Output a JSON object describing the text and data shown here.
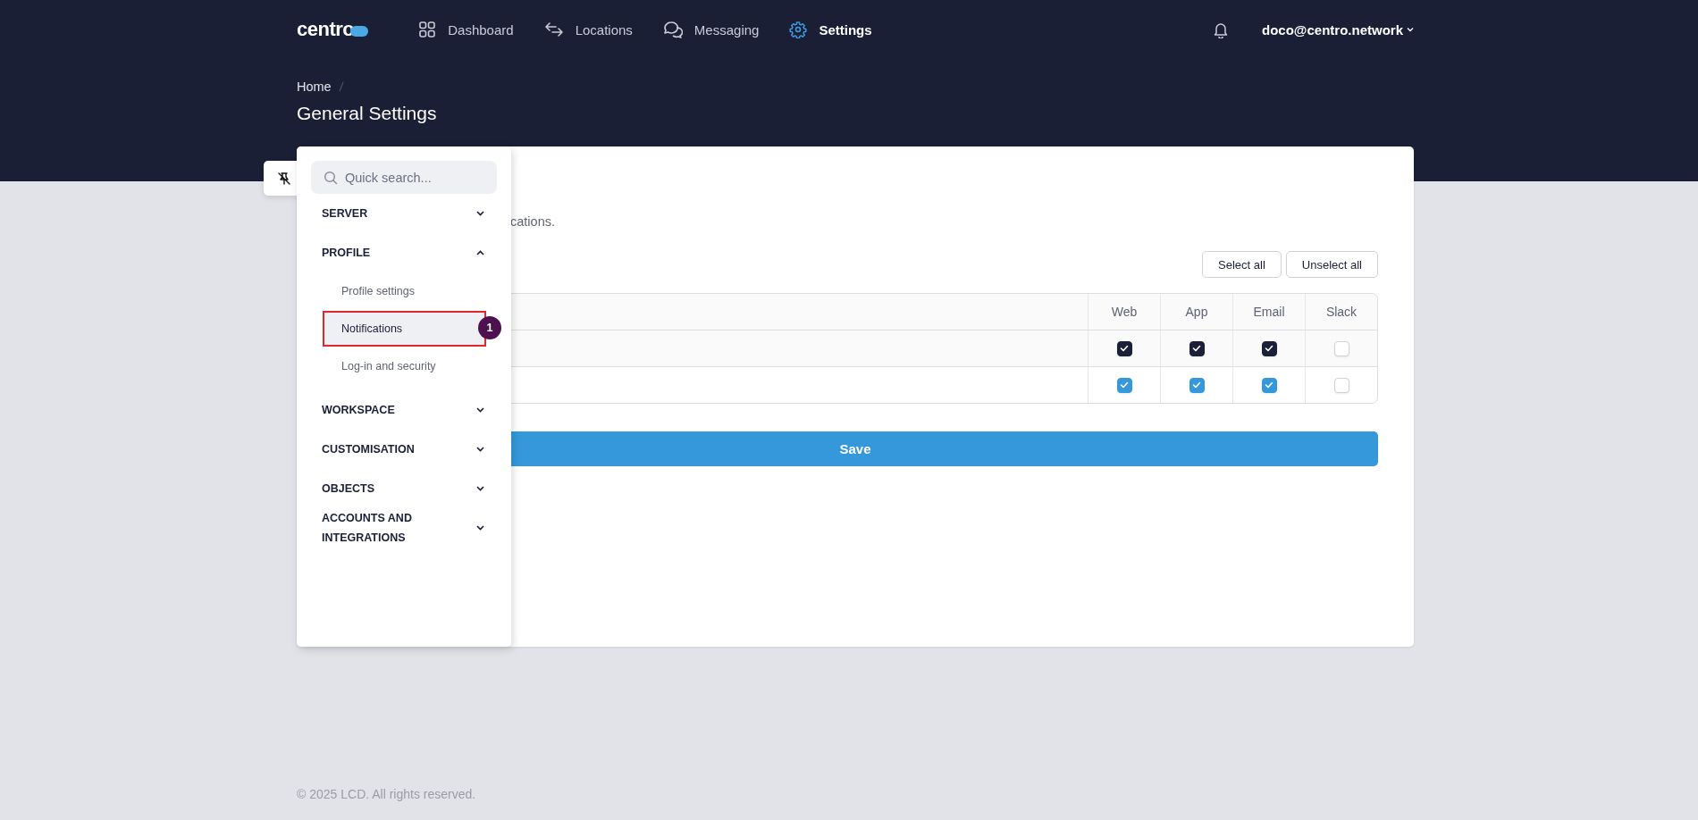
{
  "brand": {
    "name": "centro"
  },
  "nav": [
    {
      "label": "Dashboard",
      "kind": "grid",
      "selected": false
    },
    {
      "label": "Locations",
      "kind": "arrows",
      "selected": false
    },
    {
      "label": "Messaging",
      "kind": "chat",
      "selected": false
    },
    {
      "label": "Settings",
      "kind": "gear",
      "selected": true
    }
  ],
  "user": {
    "email": "doco@centro.network"
  },
  "breadcrumb": [
    "Home"
  ],
  "title": "General Settings",
  "settings_menu": {
    "search": {
      "placeholder": "Quick search..."
    },
    "sections": [
      {
        "label": "SERVER",
        "expanded": false
      },
      {
        "label": "PROFILE",
        "expanded": true,
        "children": [
          {
            "label": "Profile settings",
            "selected": false,
            "highlighted": false
          },
          {
            "label": "Notifications",
            "selected": true,
            "highlighted": true,
            "badge": "1"
          },
          {
            "label": "Log-in and security",
            "selected": false,
            "highlighted": false
          }
        ]
      },
      {
        "label": "WORKSPACE",
        "expanded": false
      },
      {
        "label": "CUSTOMISATION",
        "expanded": false
      },
      {
        "label": "OBJECTS",
        "expanded": false
      },
      {
        "label": "ACCOUNTS AND INTEGRATIONS",
        "expanded": false
      }
    ]
  },
  "description_fragment": "cations.",
  "buttons": [
    "Select all",
    "Unselect all"
  ],
  "table": {
    "columns": [
      "Web",
      "App",
      "Email",
      "Slack"
    ],
    "rows": [
      {
        "color": "#1b1f38",
        "checks": [
          true,
          true,
          true,
          false
        ]
      },
      {
        "color": "#3598db",
        "checks": [
          true,
          true,
          true,
          false
        ]
      }
    ]
  },
  "save": "Save",
  "footer": "© 2025 LCD. All rights reserved."
}
